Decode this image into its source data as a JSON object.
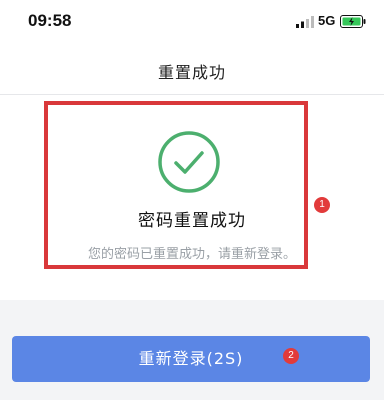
{
  "status_bar": {
    "time": "09:58",
    "network": "5G",
    "icons": [
      "signal-icon",
      "battery-charging-icon"
    ]
  },
  "nav": {
    "title": "重置成功"
  },
  "result": {
    "icon": "check-circle-icon",
    "title": "密码重置成功",
    "message": "您的密码已重置成功，请重新登录。"
  },
  "annotations": {
    "marker_1": "1",
    "marker_2": "2"
  },
  "actions": {
    "relogin_label": "重新登录(2S)"
  },
  "colors": {
    "accent": "#5b86e5",
    "success": "#4caf6e",
    "annotation": "#d9383a"
  }
}
